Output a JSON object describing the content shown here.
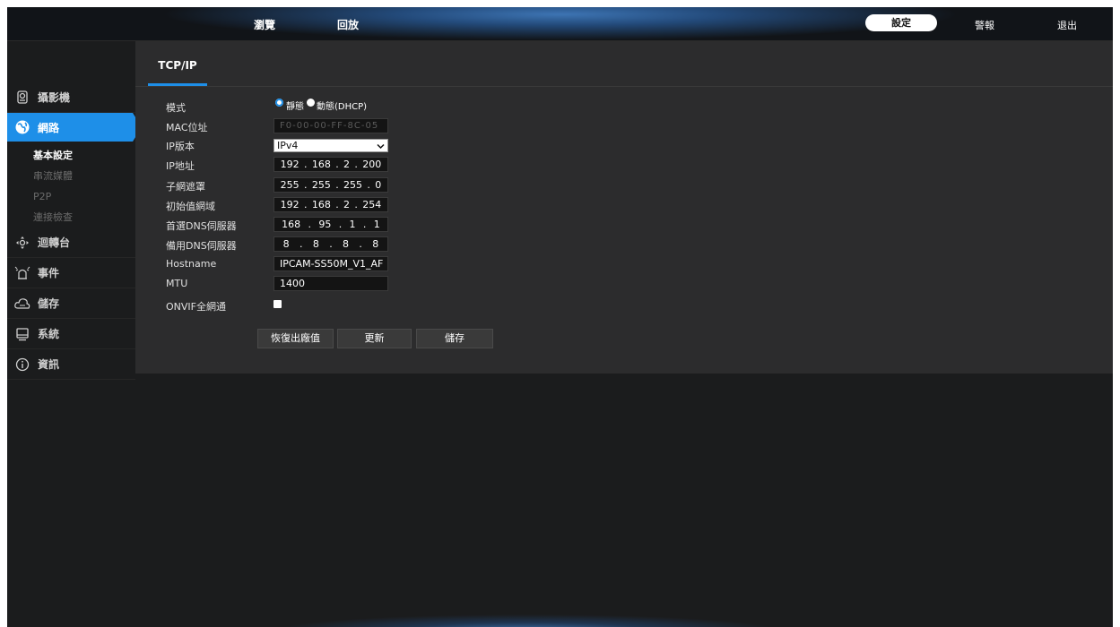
{
  "topbar": {
    "nav_left": [
      "瀏覽",
      "回放"
    ],
    "nav_right": {
      "settings": "設定",
      "alarm": "警報",
      "logout": "退出"
    }
  },
  "sidebar": {
    "items": [
      {
        "label": "攝影機",
        "icon": "camera-icon"
      },
      {
        "label": "網路",
        "icon": "network-globe-icon"
      },
      {
        "label": "迴轉台",
        "icon": "ptz-icon"
      },
      {
        "label": "事件",
        "icon": "event-alarm-icon"
      },
      {
        "label": "儲存",
        "icon": "cloud-storage-icon"
      },
      {
        "label": "系統",
        "icon": "system-monitor-icon"
      },
      {
        "label": "資訊",
        "icon": "info-icon"
      }
    ],
    "network_sub": [
      "基本設定",
      "串流媒體",
      "P2P",
      "連接檢查"
    ]
  },
  "tab": {
    "label": "TCP/IP"
  },
  "form": {
    "mode_label": "模式",
    "mode_static": "靜態",
    "mode_dhcp": "動態(DHCP)",
    "mac_label": "MAC位址",
    "mac_value": "F0-00-00-FF-8C-05",
    "ipver_label": "IP版本",
    "ipver_value": "IPv4",
    "ip_label": "IP地址",
    "ip": [
      "192",
      "168",
      "2",
      "200"
    ],
    "mask_label": "子網遮罩",
    "mask": [
      "255",
      "255",
      "255",
      "0"
    ],
    "gw_label": "初始值網域",
    "gw": [
      "192",
      "168",
      "2",
      "254"
    ],
    "dns1_label": "首選DNS伺服器",
    "dns1": [
      "168",
      "95",
      "1",
      "1"
    ],
    "dns2_label": "備用DNS伺服器",
    "dns2": [
      "8",
      "8",
      "8",
      "8"
    ],
    "hostname_label": "Hostname",
    "hostname_value": "IPCAM-SS50M_V1_AF",
    "mtu_label": "MTU",
    "mtu_value": "1400",
    "onvif_label": "ONVIF全網通"
  },
  "buttons": {
    "reset": "恢復出廠值",
    "refresh": "更新",
    "save": "儲存"
  },
  "colors": {
    "accent": "#1e8fe8",
    "panel": "#2c2c2d",
    "background": "#1b1c1d"
  }
}
